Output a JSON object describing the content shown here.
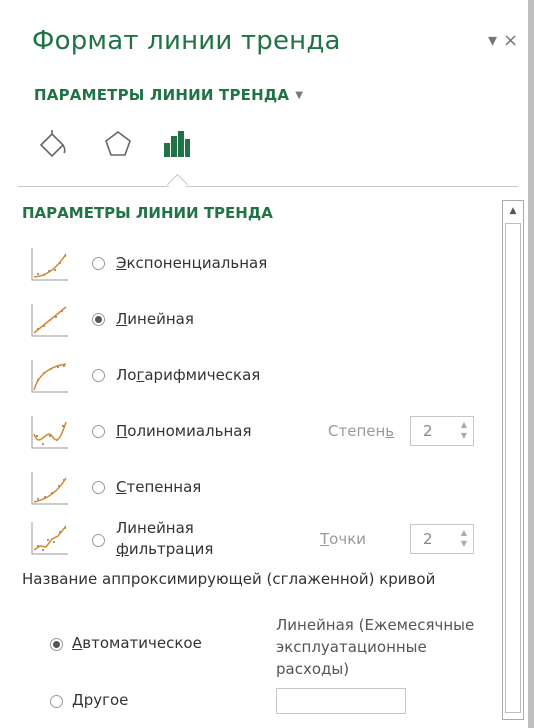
{
  "pane": {
    "title": "Формат линии тренда",
    "controls": {
      "dropdown_glyph": "▾",
      "close_glyph": "×"
    },
    "subtitle": "ПАРАМЕТРЫ ЛИНИИ ТРЕНДА",
    "subtitle_caret": "▼",
    "tabs": [
      {
        "icon": "fill-line-icon"
      },
      {
        "icon": "effects-pentagon-icon"
      },
      {
        "icon": "bar-chart-options-icon",
        "active": true
      }
    ]
  },
  "section": {
    "title": "ПАРАМЕТРЫ ЛИНИИ ТРЕНДА",
    "options": [
      {
        "label_u": "Э",
        "label_rest": "кспоненциальная",
        "checked": false,
        "icon": "exponential-trend-icon"
      },
      {
        "label_u": "Л",
        "label_rest": "инейная",
        "checked": true,
        "icon": "linear-trend-icon"
      },
      {
        "label_pre": "Ло",
        "label_u": "г",
        "label_rest": "арифмическая",
        "checked": false,
        "icon": "logarithmic-trend-icon"
      },
      {
        "label_u": "П",
        "label_rest": "олиномиальная",
        "checked": false,
        "icon": "polynomial-trend-icon"
      },
      {
        "label_u": "С",
        "label_rest": "тепенная",
        "checked": false,
        "icon": "power-trend-icon"
      },
      {
        "label_line1": "Линейная",
        "label_u": "ф",
        "label_rest": "ильтрация",
        "checked": false,
        "icon": "moving-average-trend-icon"
      }
    ],
    "degree_label_pre": "Степен",
    "degree_label_u": "ь",
    "degree_value": "2",
    "points_label_u": "Т",
    "points_label_rest": "очки",
    "points_value": "2"
  },
  "curve_name": {
    "title": "Название аппроксимирующей (сглаженной) кривой",
    "auto_label_u": "А",
    "auto_label_rest": "втоматическое",
    "auto_checked": true,
    "auto_value": "Линейная (Ежемесячные эксплуатационные расходы)",
    "other_label_u": "Д",
    "other_label_rest": "ругое",
    "other_value": ""
  }
}
